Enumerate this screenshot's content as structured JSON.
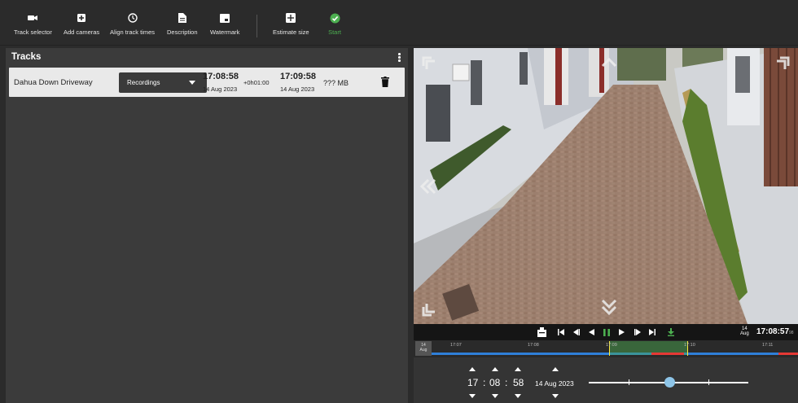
{
  "toolbar": {
    "items": [
      {
        "label": "Track selector",
        "icon": "camera-icon"
      },
      {
        "label": "Add cameras",
        "icon": "add-box-icon"
      },
      {
        "label": "Align track times",
        "icon": "clock-icon"
      },
      {
        "label": "Description",
        "icon": "document-icon"
      },
      {
        "label": "Watermark",
        "icon": "watermark-icon"
      },
      {
        "label": "Estimate size",
        "icon": "calculator-icon"
      },
      {
        "label": "Start",
        "icon": "check-circle-icon"
      }
    ],
    "start_color": "#4caf50"
  },
  "tracks": {
    "title": "Tracks",
    "rows": [
      {
        "name": "Dahua Down Driveway",
        "source": "Recordings",
        "start_time": "17:08:58",
        "start_date": "14 Aug 2023",
        "duration": "+0h01:00",
        "end_time": "17:09:58",
        "end_date": "14 Aug 2023",
        "size": "??? MB"
      }
    ]
  },
  "player": {
    "current_day": "14",
    "current_month": "Aug",
    "current_time": "17:08:57",
    "current_time_suffix": "98"
  },
  "timeline": {
    "date_day": "14",
    "date_month": "Aug",
    "ticks": [
      "17:07",
      "17:08",
      "17:09",
      "17:10",
      "17:11"
    ],
    "recording_color": "#2f7fd9",
    "event_color": "#e53935",
    "selection_color": "#4caf50"
  },
  "seek": {
    "hours": "17",
    "minutes": "08",
    "seconds": "58",
    "date": "14 Aug 2023",
    "position": 0.51
  }
}
